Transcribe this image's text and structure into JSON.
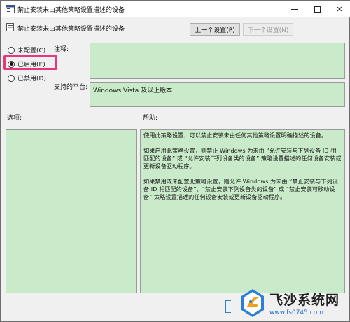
{
  "window": {
    "title": "禁止安装未由其他策略设置描述的设备",
    "minimize_glyph": "",
    "close_glyph": "✕"
  },
  "header": {
    "policy_name": "禁止安装未由其他策略设置描述的设备",
    "prev_button": "上一个设置(P)",
    "next_button": "下一个设置(N)"
  },
  "options": {
    "not_configured": "未配置(C)",
    "enabled": "已启用(E)",
    "disabled": "已禁用(D)",
    "selected": "enabled"
  },
  "comment": {
    "label": "注释:",
    "value": ""
  },
  "supported": {
    "label": "支持的平台:",
    "value": "Windows Vista 及以上版本"
  },
  "options_section": {
    "label": "选项:"
  },
  "help_section": {
    "label": "帮助:",
    "paragraphs": [
      "使用此策略设置，可以禁止安装未由任何其他策略设置明确描述的设备。",
      "如果启用此策略设置，则禁止 Windows 为未由 “允许安装与下列设备 ID 相匹配的设备” 或 “允许安装下列设备类的设备” 策略设置描述的任何设备安装或更新设备驱动程序。",
      "如果禁用或未配置此策略设置，则允许 Windows 为未由 “禁止安装与下列设备 ID 相匹配的设备”、“禁止安装下列设备类的设备” 或 “禁止安装可移动设备” 策略设置描述的任何设备安装或更新设备驱动程序。"
    ]
  },
  "watermark": {
    "name": "飞沙系统网",
    "url": "www.fs0745.com"
  },
  "colors": {
    "panel_green": "#c9ebc9",
    "highlight": "#e8367f",
    "window_bg": "#f0f0f0",
    "watermark_url": "#1f6fd0"
  }
}
